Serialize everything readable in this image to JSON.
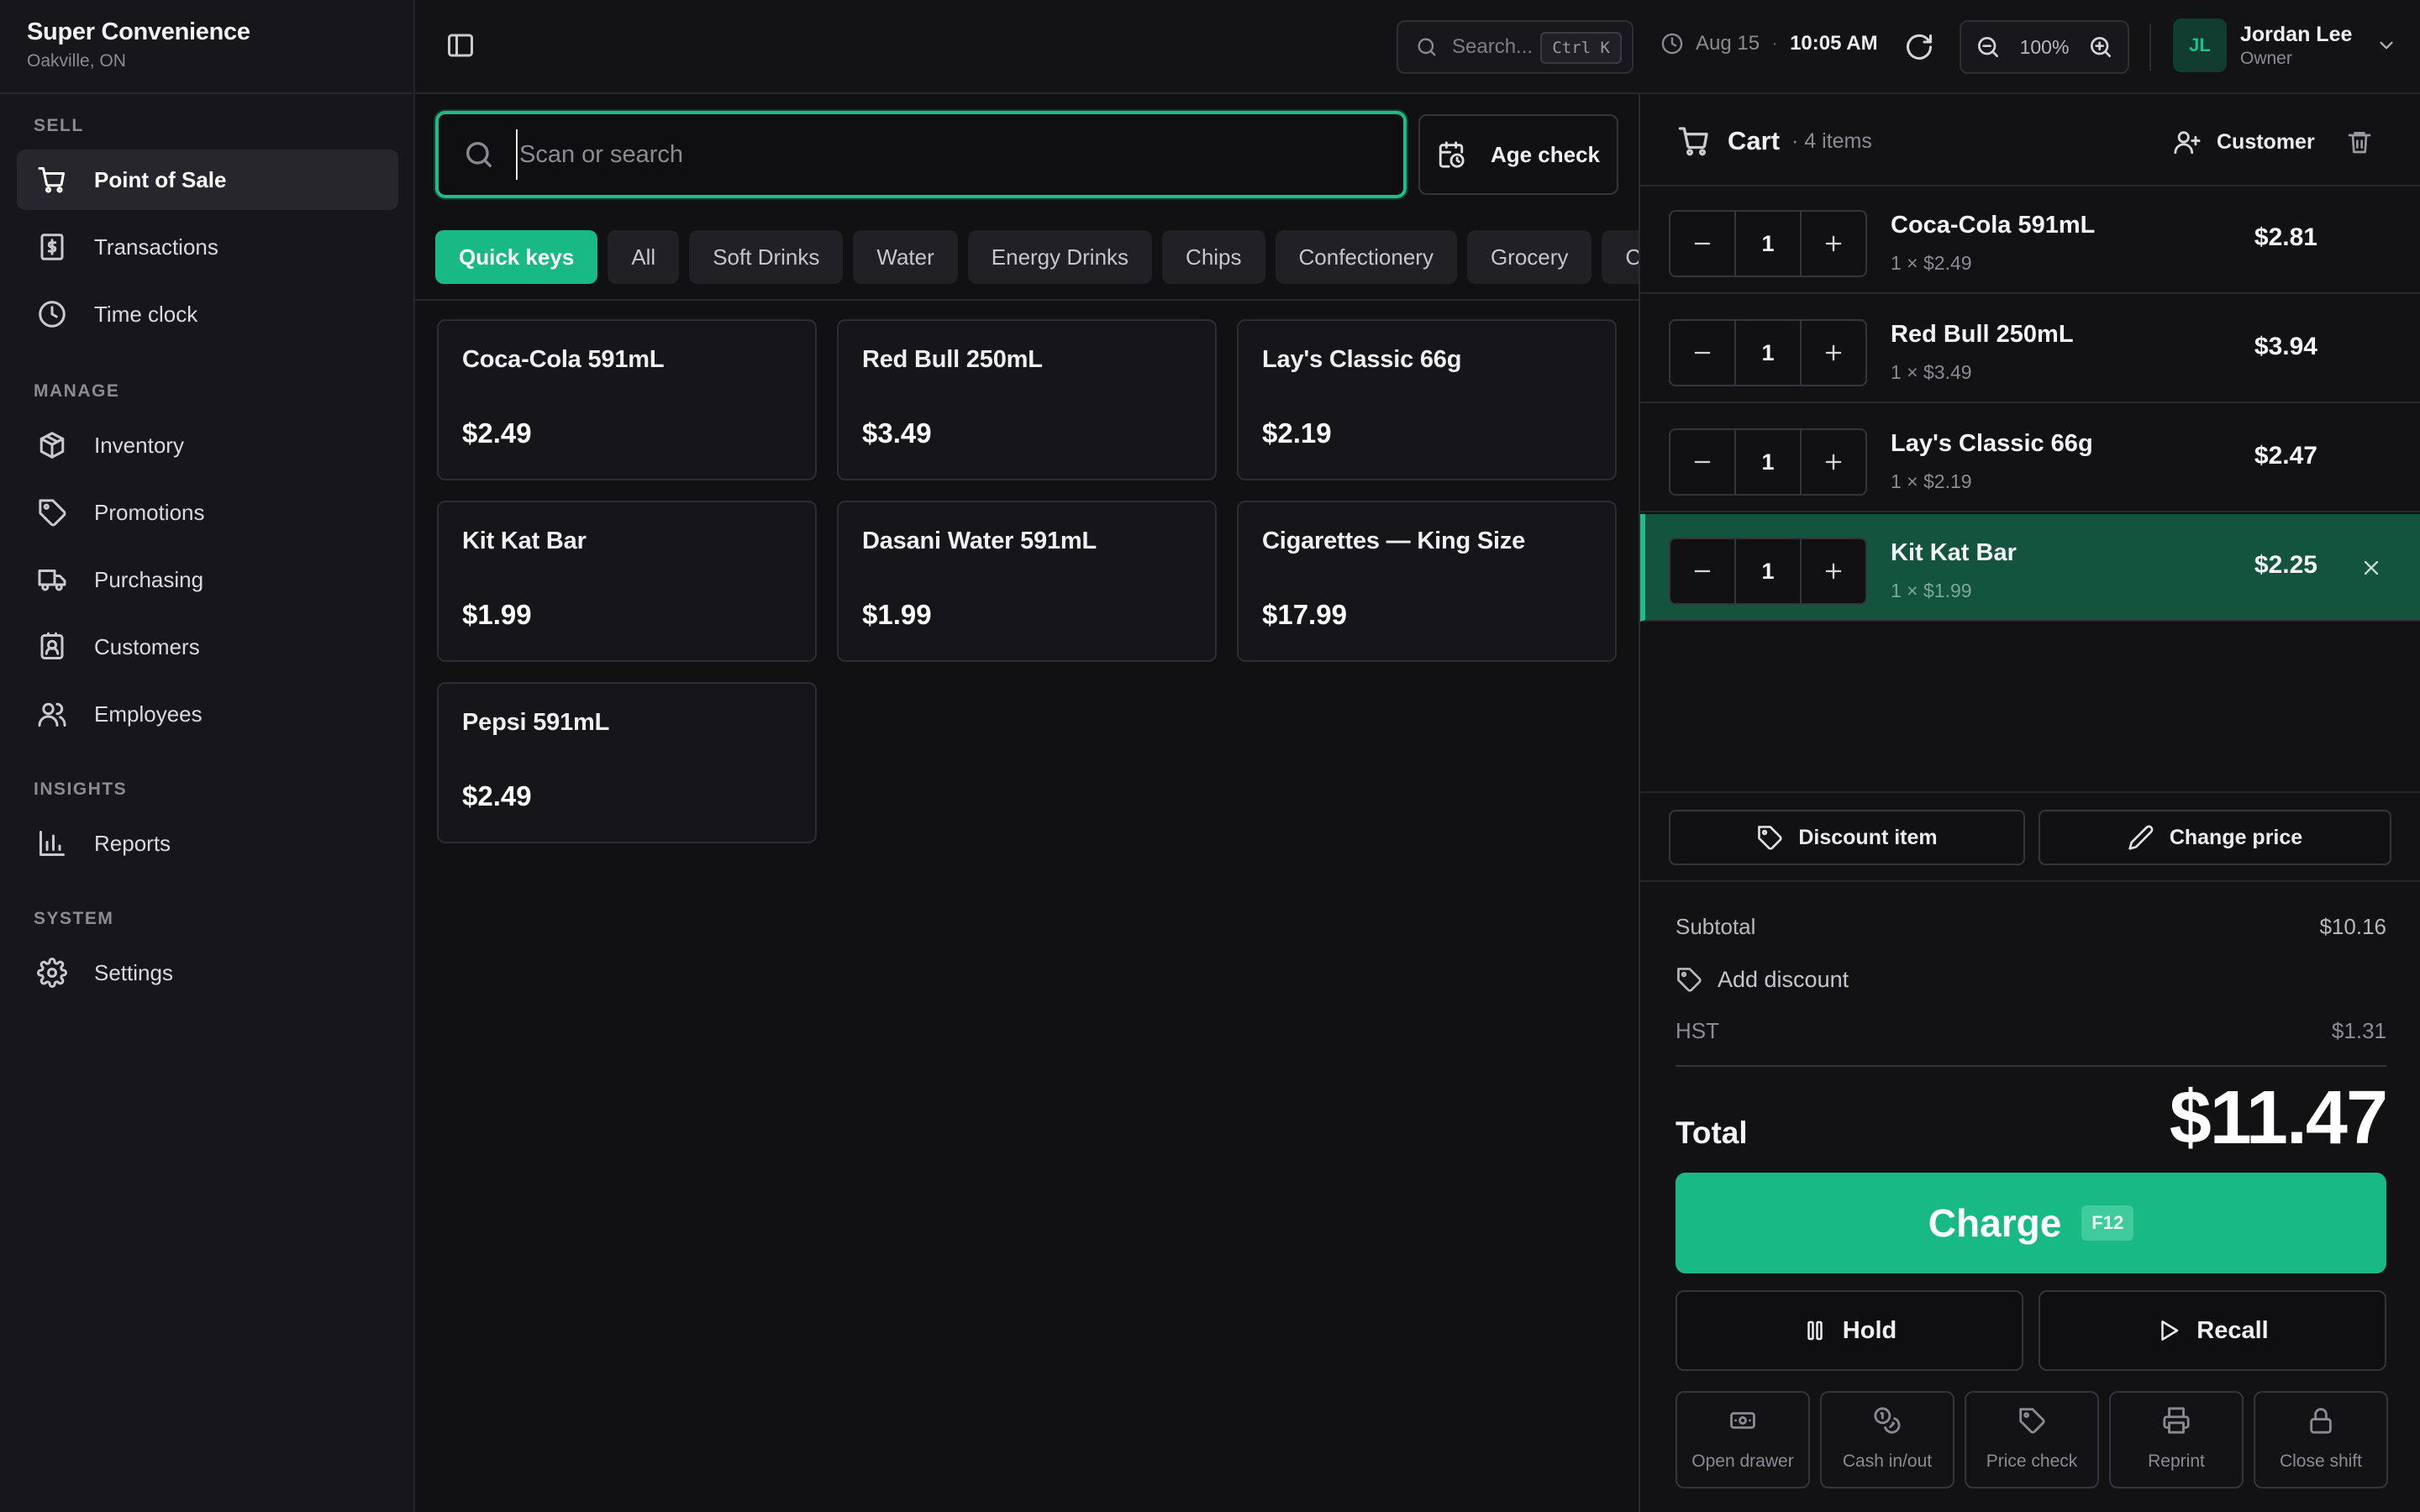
{
  "brand": {
    "name": "Super Convenience",
    "location": "Oakville, ON"
  },
  "sidebar": {
    "sections": {
      "sell": "SELL",
      "manage": "MANAGE",
      "insights": "INSIGHTS",
      "system": "SYSTEM"
    },
    "items": [
      {
        "label": "Point of Sale",
        "icon": "cart-icon",
        "active": true
      },
      {
        "label": "Transactions",
        "icon": "receipt-icon"
      },
      {
        "label": "Time clock",
        "icon": "clock-icon"
      },
      {
        "label": "Inventory",
        "icon": "box-icon"
      },
      {
        "label": "Promotions",
        "icon": "tag-icon"
      },
      {
        "label": "Purchasing",
        "icon": "truck-icon"
      },
      {
        "label": "Customers",
        "icon": "contact-icon"
      },
      {
        "label": "Employees",
        "icon": "users-icon"
      },
      {
        "label": "Reports",
        "icon": "bar-chart-icon"
      },
      {
        "label": "Settings",
        "icon": "gear-icon"
      }
    ]
  },
  "topbar": {
    "search_placeholder": "Search...",
    "search_shortcut": "Ctrl K",
    "date": "Aug 15",
    "time": "10:05 AM",
    "zoom": "100%",
    "user": {
      "initials": "JL",
      "name": "Jordan Lee",
      "role": "Owner"
    }
  },
  "main": {
    "scan_placeholder": "Scan or search",
    "age_check_label": "Age check",
    "categories": [
      "Quick keys",
      "All",
      "Soft Drinks",
      "Water",
      "Energy Drinks",
      "Chips",
      "Confectionery",
      "Grocery",
      "Candy"
    ],
    "active_category": "Quick keys",
    "products": [
      {
        "name": "Coca-Cola 591mL",
        "price": "$2.49"
      },
      {
        "name": "Red Bull 250mL",
        "price": "$3.49"
      },
      {
        "name": "Lay's Classic 66g",
        "price": "$2.19"
      },
      {
        "name": "Kit Kat Bar",
        "price": "$1.99"
      },
      {
        "name": "Dasani Water 591mL",
        "price": "$1.99"
      },
      {
        "name": "Cigarettes — King Size",
        "price": "$17.99"
      },
      {
        "name": "Pepsi 591mL",
        "price": "$2.49"
      }
    ]
  },
  "cart": {
    "title": "Cart",
    "count": "· 4 items",
    "customer_label": "Customer",
    "lines": [
      {
        "name": "Coca-Cola 591mL",
        "qty": "1",
        "sub": "1 × $2.49",
        "total": "$2.81"
      },
      {
        "name": "Red Bull 250mL",
        "qty": "1",
        "sub": "1 × $3.49",
        "total": "$3.94"
      },
      {
        "name": "Lay's Classic 66g",
        "qty": "1",
        "sub": "1 × $2.19",
        "total": "$2.47"
      },
      {
        "name": "Kit Kat Bar",
        "qty": "1",
        "sub": "1 × $1.99",
        "total": "$2.25",
        "selected": true
      }
    ],
    "discount_item_label": "Discount item",
    "change_price_label": "Change price",
    "subtotal_label": "Subtotal",
    "subtotal": "$10.16",
    "add_discount_label": "Add discount",
    "tax_label": "HST",
    "tax": "$1.31",
    "total_label": "Total",
    "total": "$11.47",
    "charge_label": "Charge",
    "charge_shortcut": "F12",
    "hold_label": "Hold",
    "recall_label": "Recall",
    "utilities": [
      {
        "label": "Open drawer",
        "icon": "cash-drawer-icon"
      },
      {
        "label": "Cash in/out",
        "icon": "coins-icon"
      },
      {
        "label": "Price check",
        "icon": "tag-icon"
      },
      {
        "label": "Reprint",
        "icon": "printer-icon"
      },
      {
        "label": "Close shift",
        "icon": "lock-icon"
      }
    ]
  },
  "colors": {
    "accent": "#19b986",
    "selected_row": "#12543d",
    "background": "#111114",
    "sidebar": "#17171b"
  }
}
